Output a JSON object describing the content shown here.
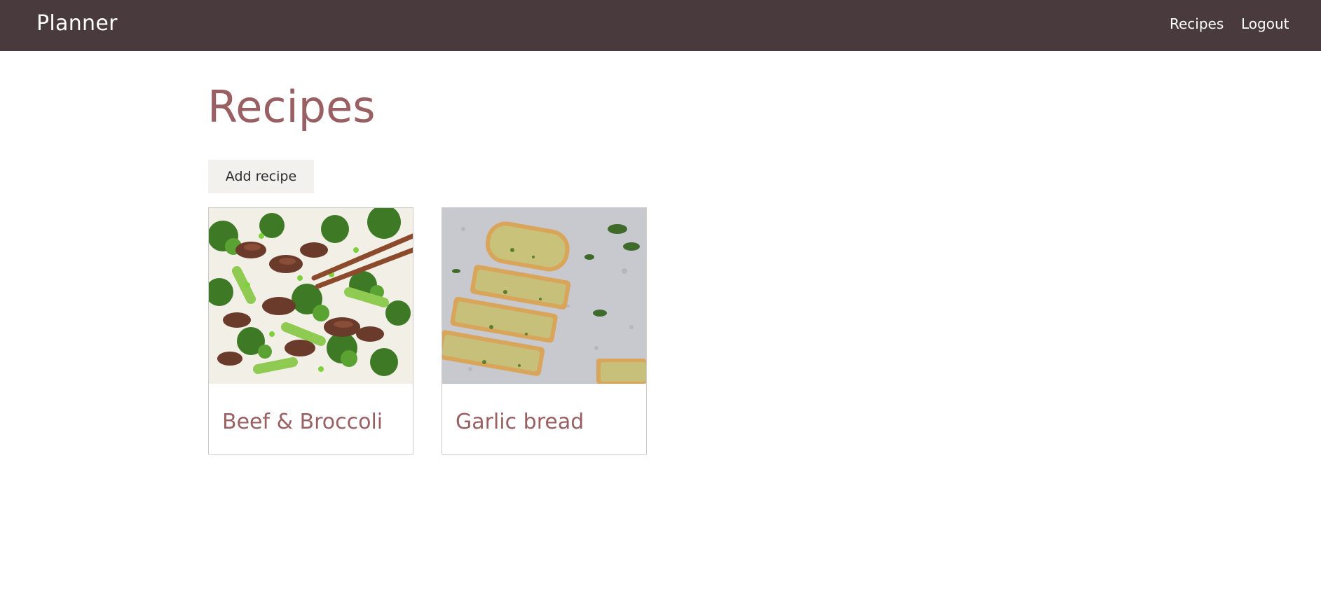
{
  "navbar": {
    "brand": "Planner",
    "links": [
      {
        "label": "Recipes"
      },
      {
        "label": "Logout"
      }
    ],
    "background": "#483a3d"
  },
  "main": {
    "title": "Recipes",
    "add_button_label": "Add recipe",
    "accent_color": "#9a5f63",
    "recipes": [
      {
        "title": "Beef & Broccoli",
        "image": "beef-and-broccoli-photo"
      },
      {
        "title": "Garlic bread",
        "image": "garlic-bread-photo"
      }
    ]
  }
}
